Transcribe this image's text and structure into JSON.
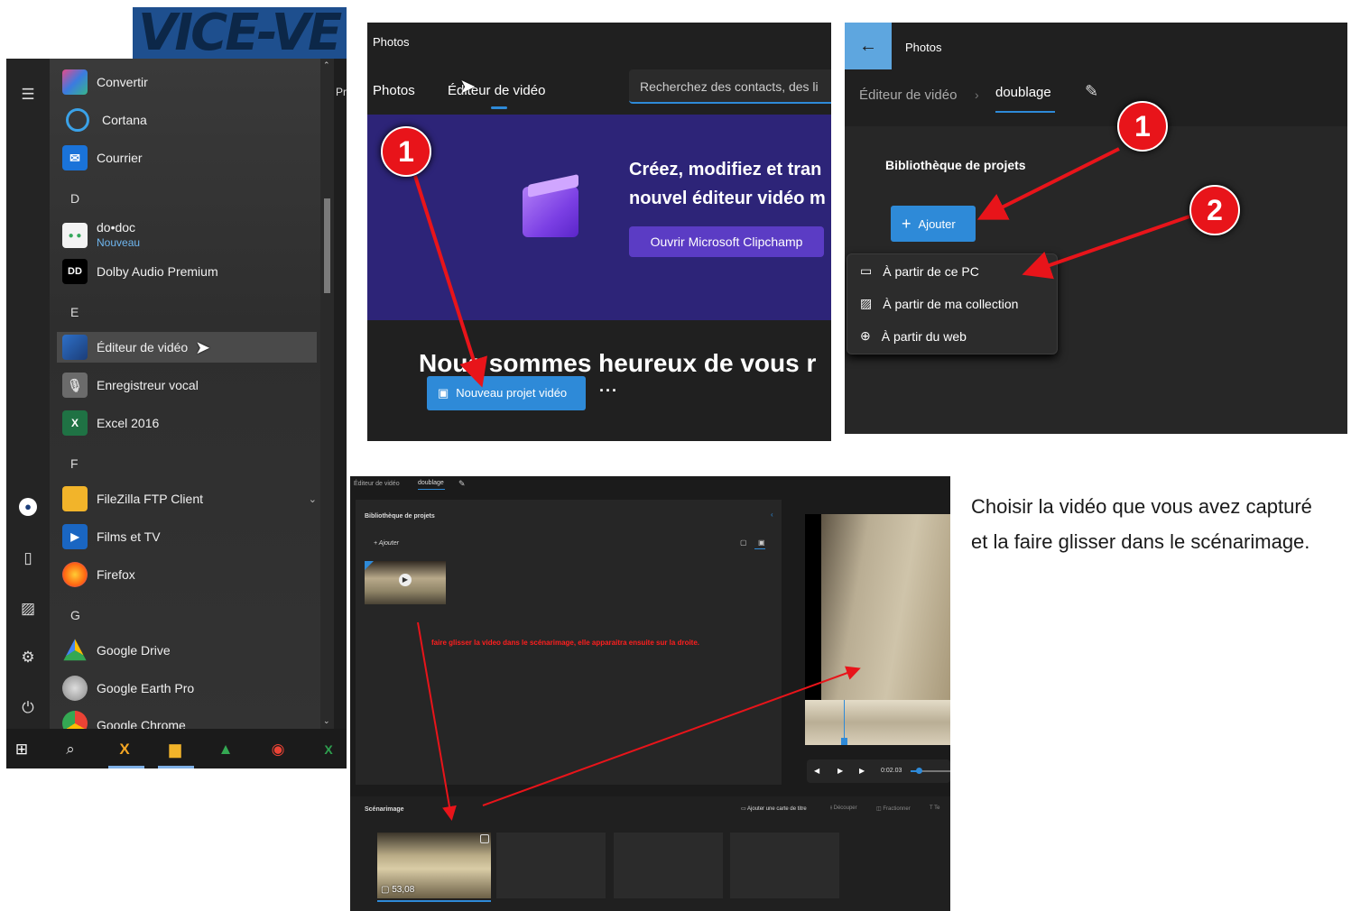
{
  "start_menu": {
    "banner_text": "VICE-VE",
    "partial_label": "Pr",
    "apps": [
      {
        "label": "Convertir",
        "icon": "convertir-icon"
      },
      {
        "label": "Cortana",
        "icon": "cortana-icon"
      },
      {
        "label": "Courrier",
        "icon": "mail-icon"
      },
      {
        "label": "do•doc",
        "sublabel": "Nouveau",
        "icon": "dodoc-icon"
      },
      {
        "label": "Dolby Audio Premium",
        "icon": "dolby-icon"
      },
      {
        "label": "Éditeur de vidéo",
        "icon": "video-editor-icon"
      },
      {
        "label": "Enregistreur vocal",
        "icon": "microphone-icon"
      },
      {
        "label": "Excel 2016",
        "icon": "excel-icon"
      },
      {
        "label": "FileZilla FTP Client",
        "icon": "folder-icon"
      },
      {
        "label": "Films et TV",
        "icon": "films-tv-icon"
      },
      {
        "label": "Firefox",
        "icon": "firefox-icon"
      },
      {
        "label": "Google Drive",
        "icon": "google-drive-icon"
      },
      {
        "label": "Google Earth Pro",
        "icon": "google-earth-icon"
      },
      {
        "label": "Google Chrome",
        "icon": "chrome-icon"
      }
    ],
    "letters": [
      "D",
      "E",
      "F",
      "G"
    ]
  },
  "panel_photos_home": {
    "app_title": "Photos",
    "tabs": [
      "Photos",
      "Éditeur de vidéo"
    ],
    "search_placeholder": "Recherchez des contacts, des li",
    "banner_line1": "Créez, modifiez et tran",
    "banner_line2": "nouvel éditeur vidéo m",
    "clipchamp_button": "Ouvrir Microsoft Clipchamp",
    "welcome_text": "Nous sommes heureux de vous r",
    "new_project_button": "Nouveau projet vidéo",
    "more_label": "···",
    "badge": "1"
  },
  "panel_project": {
    "app_title": "Photos",
    "breadcrumb_parent": "Éditeur de vidéo",
    "breadcrumb_current": "doublage",
    "library_title": "Bibliothèque de projets",
    "add_button": "Ajouter",
    "menu_items": [
      "À partir de ce PC",
      "À partir de ma collection",
      "À partir du web"
    ],
    "badge1": "1",
    "badge2": "2"
  },
  "panel_storyboard": {
    "breadcrumb_parent": "Éditeur de vidéo",
    "breadcrumb_current": "doublage",
    "library_title": "Bibliothèque de projets",
    "add_label": "Ajouter",
    "annotation": "faire glisser la video dans le scénarimage, elle apparaitra ensuite sur la droite.",
    "storyboard_title": "Scénarimage",
    "toolbar": [
      "Ajouter une carte de titre",
      "Découper",
      "Fractionner",
      "Te"
    ],
    "time_label": "0:02.03",
    "clip_duration": "53,08"
  },
  "instructions": "Choisir la vidéo que vous avez capturé et la faire glisser dans le scénarimage.",
  "colors": {
    "accent": "#2e8ad8",
    "clipchamp": "#5b3cc4",
    "annotation_red": "#e8141a"
  }
}
